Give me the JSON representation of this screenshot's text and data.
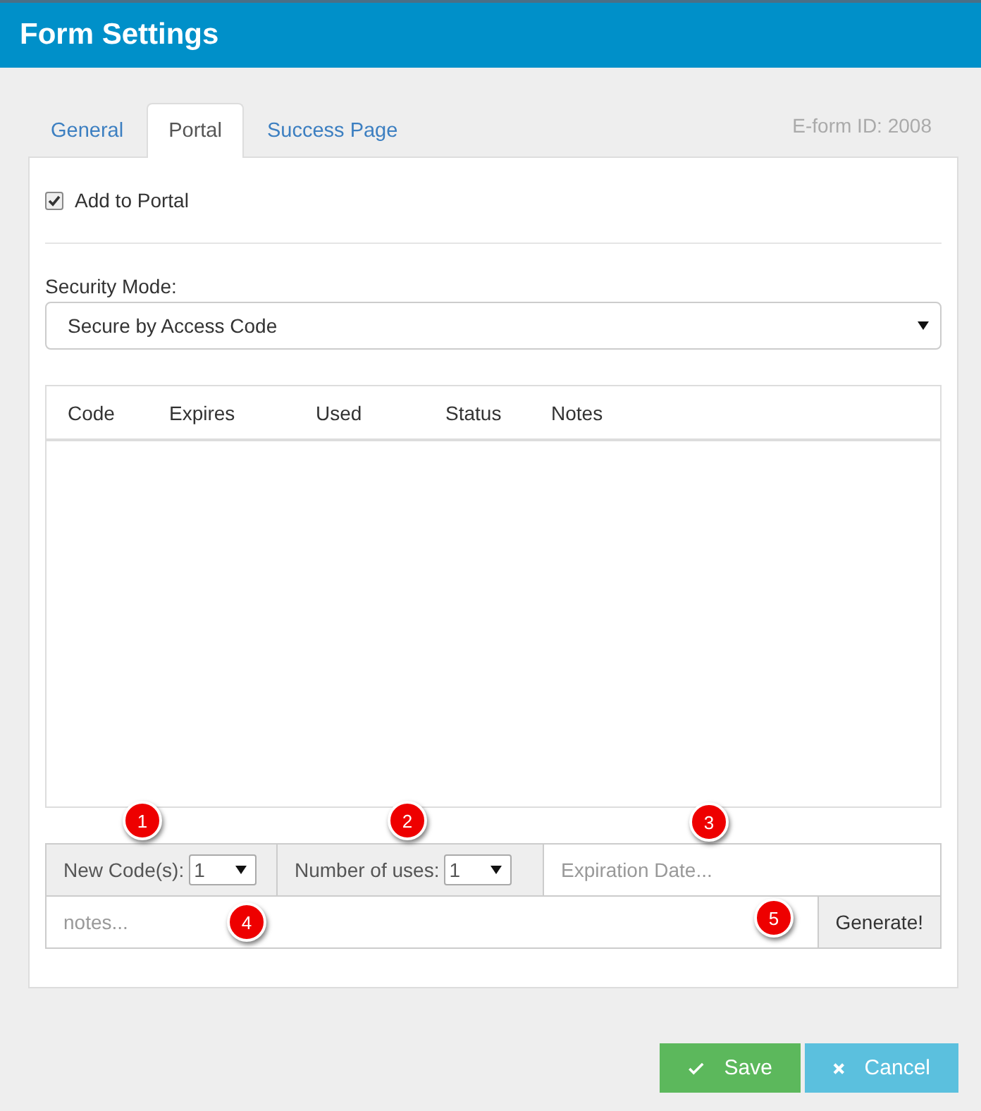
{
  "window": {
    "title": "Form Settings"
  },
  "tabs": [
    {
      "label": "General",
      "selected": false
    },
    {
      "label": "Portal",
      "selected": true
    },
    {
      "label": "Success Page",
      "selected": false
    }
  ],
  "form_id": "E-form ID: 2008",
  "add_to_portal": {
    "label": "Add to Portal",
    "checked": true
  },
  "security_mode": {
    "label": "Security Mode:",
    "value": "Secure by Access Code"
  },
  "codes_table": {
    "columns": [
      "Code",
      "Expires",
      "Used",
      "Status",
      "Notes"
    ]
  },
  "generator": {
    "new_codes": {
      "label": "New Code(s):",
      "value": "1"
    },
    "number_of_uses": {
      "label": "Number of uses:",
      "value": "1"
    },
    "expiration_date": {
      "placeholder": "Expiration Date..."
    },
    "notes": {
      "placeholder": "notes..."
    },
    "generate_button": "Generate!"
  },
  "callouts": [
    "1",
    "2",
    "3",
    "4",
    "5"
  ],
  "buttons": [
    {
      "kind": "save",
      "label": "Save"
    },
    {
      "kind": "cancel",
      "label": "Cancel"
    }
  ]
}
